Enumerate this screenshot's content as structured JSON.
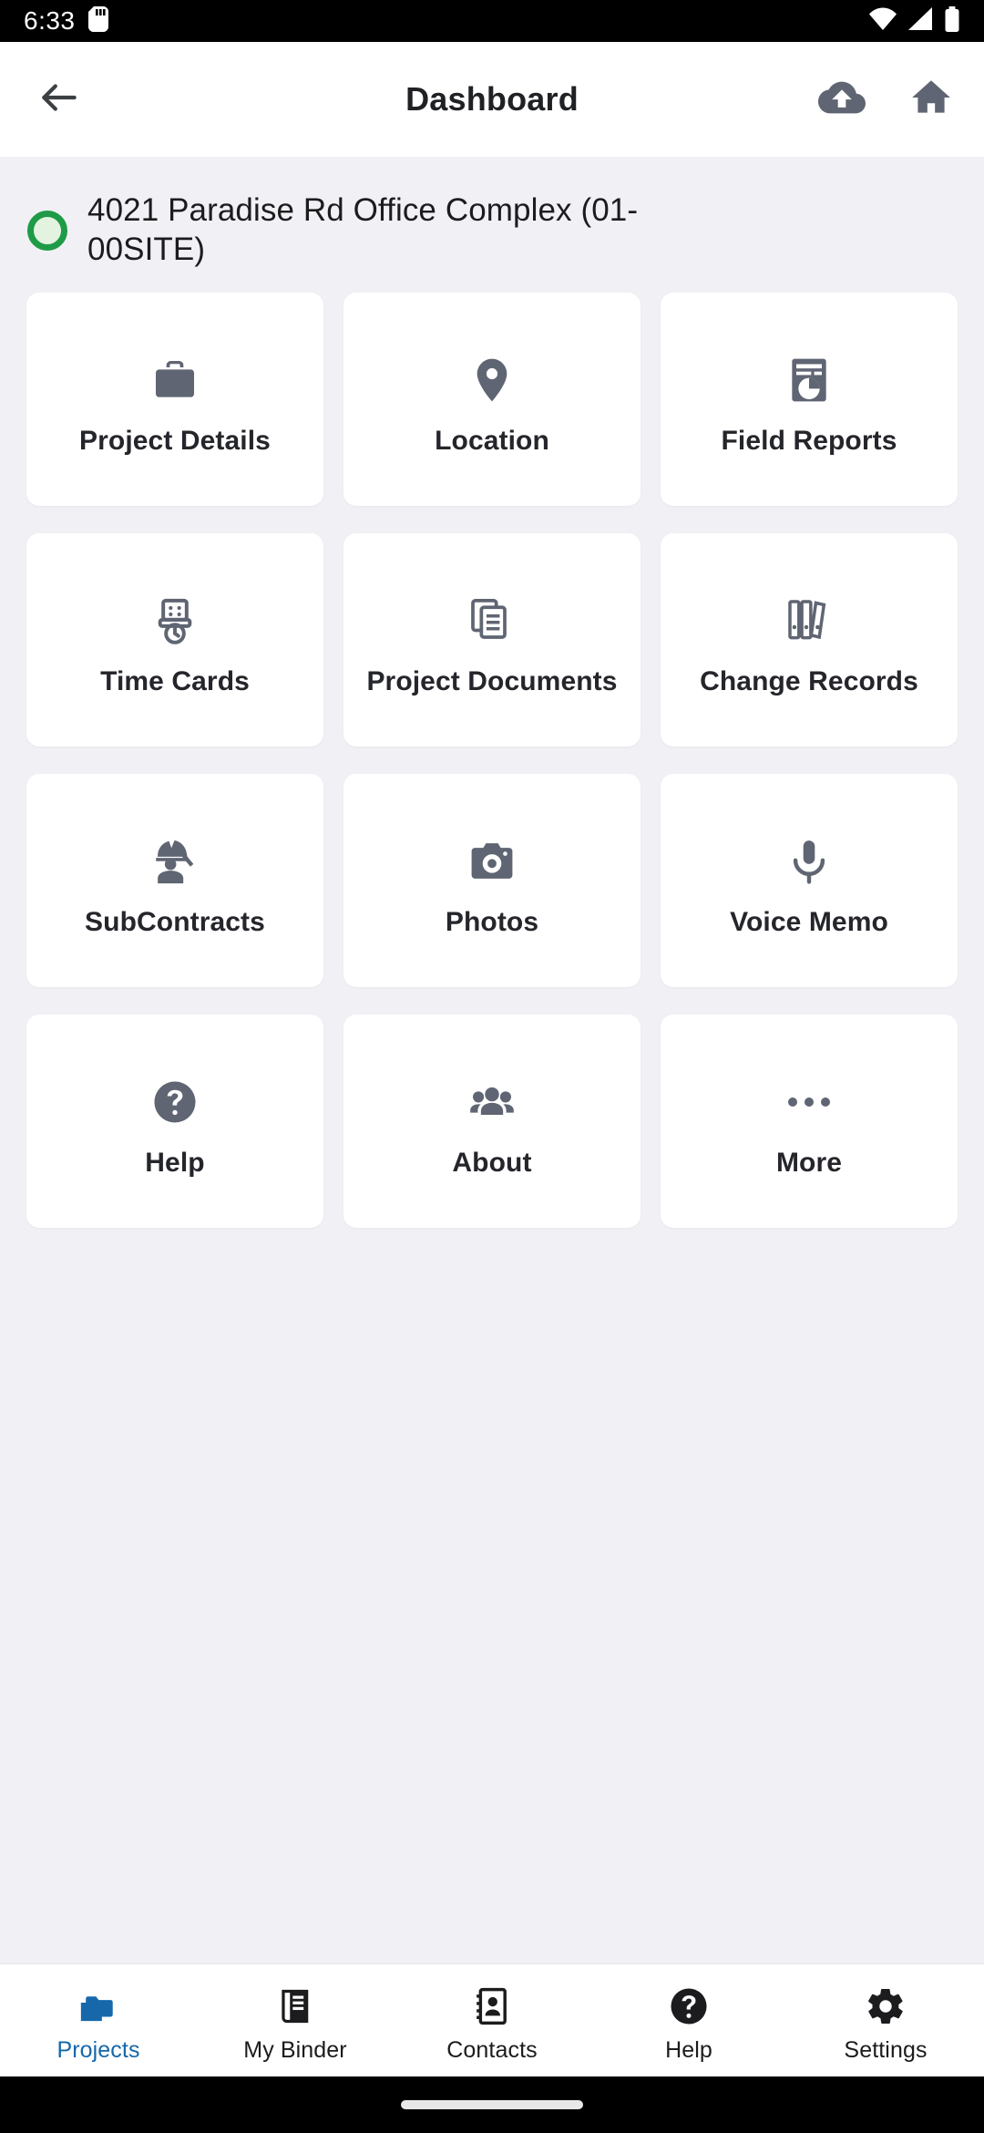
{
  "status_bar": {
    "time": "6:33",
    "icons": [
      "sd-card-icon",
      "wifi-icon",
      "cellular-signal-icon",
      "battery-icon"
    ]
  },
  "app_bar": {
    "title": "Dashboard",
    "back_icon": "arrow-back-icon",
    "actions": [
      {
        "name": "cloud-upload-icon",
        "label": "Cloud Upload"
      },
      {
        "name": "home-icon",
        "label": "Home"
      }
    ]
  },
  "project": {
    "title": "4021 Paradise Rd Office Complex (01-00SITE)",
    "status_color": "#1f9b47",
    "status_fill": "#e4f3e0"
  },
  "tiles": [
    {
      "label": "Project Details",
      "icon": "briefcase-icon"
    },
    {
      "label": "Location",
      "icon": "map-pin-icon"
    },
    {
      "label": "Field Reports",
      "icon": "report-chart-icon"
    },
    {
      "label": "Time Cards",
      "icon": "punch-clock-icon"
    },
    {
      "label": "Project Documents",
      "icon": "documents-copy-icon"
    },
    {
      "label": "Change Records",
      "icon": "binders-icon"
    },
    {
      "label": "SubContracts",
      "icon": "hard-hat-worker-icon"
    },
    {
      "label": "Photos",
      "icon": "camera-icon"
    },
    {
      "label": "Voice Memo",
      "icon": "microphone-icon"
    },
    {
      "label": "Help",
      "icon": "help-circle-icon"
    },
    {
      "label": "About",
      "icon": "people-group-icon"
    },
    {
      "label": "More",
      "icon": "ellipsis-icon"
    }
  ],
  "bottom_nav": {
    "active_color": "#1668ab",
    "items": [
      {
        "label": "Projects",
        "icon": "folders-icon",
        "active": true
      },
      {
        "label": "My Binder",
        "icon": "binder-icon",
        "active": false
      },
      {
        "label": "Contacts",
        "icon": "contacts-icon",
        "active": false
      },
      {
        "label": "Help",
        "icon": "help-icon",
        "active": false
      },
      {
        "label": "Settings",
        "icon": "gear-icon",
        "active": false
      }
    ]
  },
  "colors": {
    "background": "#f1f0f5",
    "tile_background": "#ffffff",
    "icon_gray": "#5f6572",
    "text_dark": "#25262b"
  }
}
